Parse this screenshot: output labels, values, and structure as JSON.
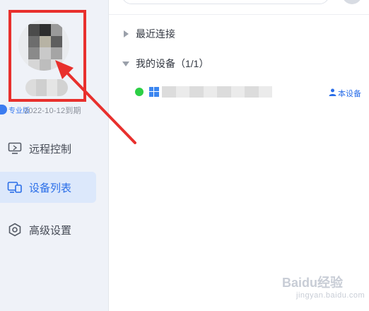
{
  "sidebar": {
    "plan_label": "专业版",
    "expire_text": "2022-10-12到期",
    "nav": [
      {
        "label": "远程控制",
        "icon": "monitor-icon",
        "active": false
      },
      {
        "label": "设备列表",
        "icon": "devices-icon",
        "active": true
      },
      {
        "label": "高级设置",
        "icon": "settings-icon",
        "active": false
      }
    ]
  },
  "main": {
    "groups": [
      {
        "label": "最近连接",
        "expanded": false
      },
      {
        "label": "我的设备（1/1）",
        "expanded": true
      }
    ],
    "devices": [
      {
        "status": "online",
        "this_device_label": "本设备"
      }
    ]
  },
  "watermark": {
    "text": "Baidu经验",
    "sub": "jingyan.baidu.com"
  },
  "colors": {
    "accent": "#2a6ee8",
    "sidebar_bg": "#eff2f8",
    "active_bg": "#dce8fb",
    "online": "#2ccf45",
    "annotation": "#e8302d"
  }
}
